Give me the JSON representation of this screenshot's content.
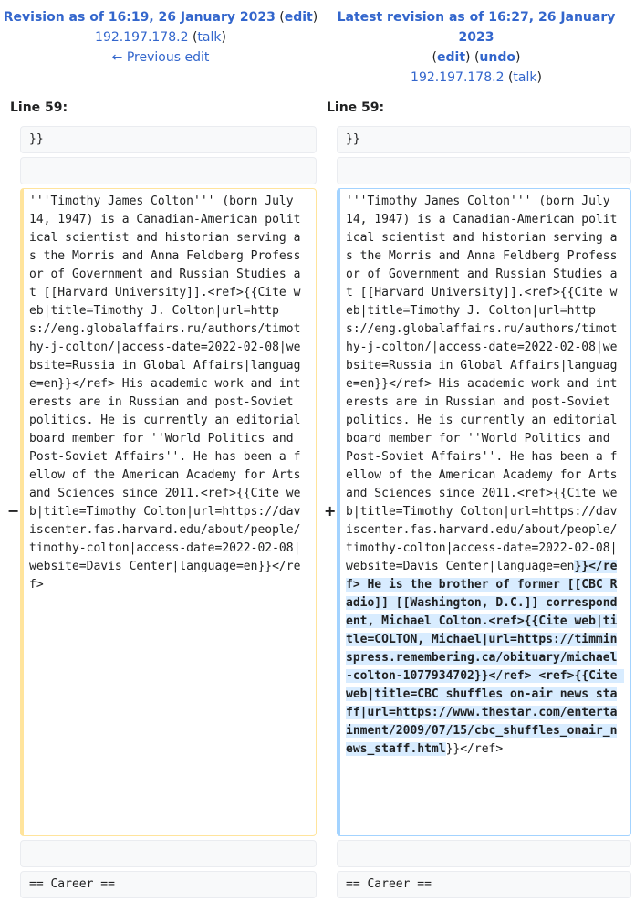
{
  "left_header": {
    "title": "Revision as of 16:19, 26 January 2023",
    "edit": "edit",
    "user": "192.197.178.2",
    "talk": "talk",
    "prev_edit": "← Previous edit"
  },
  "right_header": {
    "title": "Latest revision as of 16:27, 26 January 2023",
    "edit": "edit",
    "undo": "undo",
    "user": "192.197.178.2",
    "talk": "talk"
  },
  "left_line_label": "Line 59:",
  "right_line_label": "Line 59:",
  "rows": {
    "braces": "}}",
    "career": "== Career =="
  },
  "markers": {
    "minus": "−",
    "plus": "+"
  },
  "left_paragraph": "'''Timothy James Colton''' (born July 14, 1947) is a Canadian-American political scientist and historian serving as the Morris and Anna Feldberg Professor of Government and Russian Studies at [[Harvard University]].<ref>{{Cite web|title=Timothy J. Colton|url=https://eng.globalaffairs.ru/authors/timothy-j-colton/|access-date=2022-02-08|website=Russia in Global Affairs|language=en}}</ref> His academic work and interests are in Russian and post-Soviet politics. He is currently an editorial board member for ''World Politics and Post-Soviet Affairs''. He has been a fellow of the American Academy for Arts and Sciences since 2011.<ref>{{Cite web|title=Timothy Colton|url=https://daviscenter.fas.harvard.edu/about/people/timothy-colton|access-date=2022-02-08|website=Davis Center|language=en}}</ref>",
  "right_paragraph": {
    "before": "'''Timothy James Colton''' (born July 14, 1947) is a Canadian-American political scientist and historian serving as the Morris and Anna Feldberg Professor of Government and Russian Studies at [[Harvard University]].<ref>{{Cite web|title=Timothy J. Colton|url=https://eng.globalaffairs.ru/authors/timothy-j-colton/|access-date=2022-02-08|website=Russia in Global Affairs|language=en}}</ref> His academic work and interests are in Russian and post-Soviet politics. He is currently an editorial board member for ''World Politics and Post-Soviet Affairs''. He has been a fellow of the American Academy for Arts and Sciences since 2011.<ref>{{Cite web|title=Timothy Colton|url=https://daviscenter.fas.harvard.edu/about/people/timothy-colton|access-date=2022-02-08|website=Davis Center|language=en",
    "inserted": "}}</ref> He is the brother of former [[CBC Radio]] [[Washington, D.C.]] correspondent, Michael Colton.<ref>{{Cite web|title=COLTON, Michael|url=https://timminspress.remembering.ca/obituary/michael-colton-1077934702}}</ref> <ref>{{Cite web|title=CBC shuffles on-air news staff|url=https://www.thestar.com/entertainment/2009/07/15/cbc_shuffles_onair_news_staff.html",
    "after": "}}</ref>"
  }
}
